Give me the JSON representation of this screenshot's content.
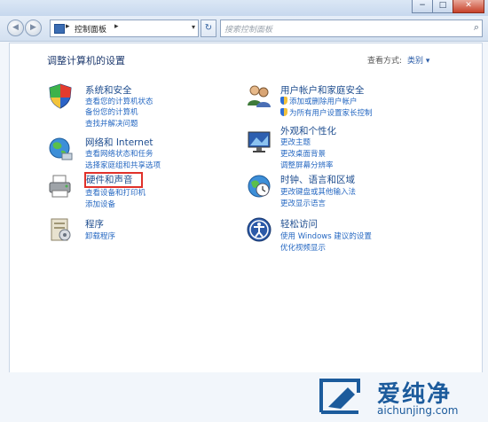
{
  "window": {
    "caption_buttons": [
      "−",
      "□",
      "✕"
    ]
  },
  "nav": {
    "back": "◀",
    "forward": "▶",
    "breadcrumb": "控制面板",
    "breadcrumb_arrow": "▸",
    "refresh": "↻",
    "search_placeholder": "搜索控制面板"
  },
  "main": {
    "title": "调整计算机的设置",
    "view_by_label": "查看方式:",
    "view_by_value": "类别 ▾"
  },
  "categories": [
    {
      "title": "系统和安全",
      "icon": "shield-icon",
      "links": [
        "查看您的计算机状态",
        "备份您的计算机",
        "查找并解决问题"
      ]
    },
    {
      "title": "网络和 Internet",
      "icon": "network-globe-icon",
      "links": [
        "查看网络状态和任务",
        "选择家庭组和共享选项"
      ]
    },
    {
      "title": "硬件和声音",
      "icon": "printer-icon",
      "links": [
        "查看设备和打印机",
        "添加设备"
      ]
    },
    {
      "title": "程序",
      "icon": "programs-icon",
      "links": [
        "卸载程序"
      ]
    },
    {
      "title": "用户帐户和家庭安全",
      "icon": "users-icon",
      "links": [
        "添加或删除用户帐户",
        "为所有用户设置家长控制"
      ]
    },
    {
      "title": "外观和个性化",
      "icon": "monitor-icon",
      "links": [
        "更改主题",
        "更改桌面背景",
        "调整屏幕分辨率"
      ]
    },
    {
      "title": "时钟、语言和区域",
      "icon": "clock-globe-icon",
      "links": [
        "更改键盘或其他输入法",
        "更改显示语言"
      ]
    },
    {
      "title": "轻松访问",
      "icon": "ease-of-access-icon",
      "links": [
        "使用 Windows 建议的设置",
        "优化视频显示"
      ]
    }
  ],
  "watermark": {
    "title": "爱纯净",
    "url": "aichunjing.com"
  }
}
